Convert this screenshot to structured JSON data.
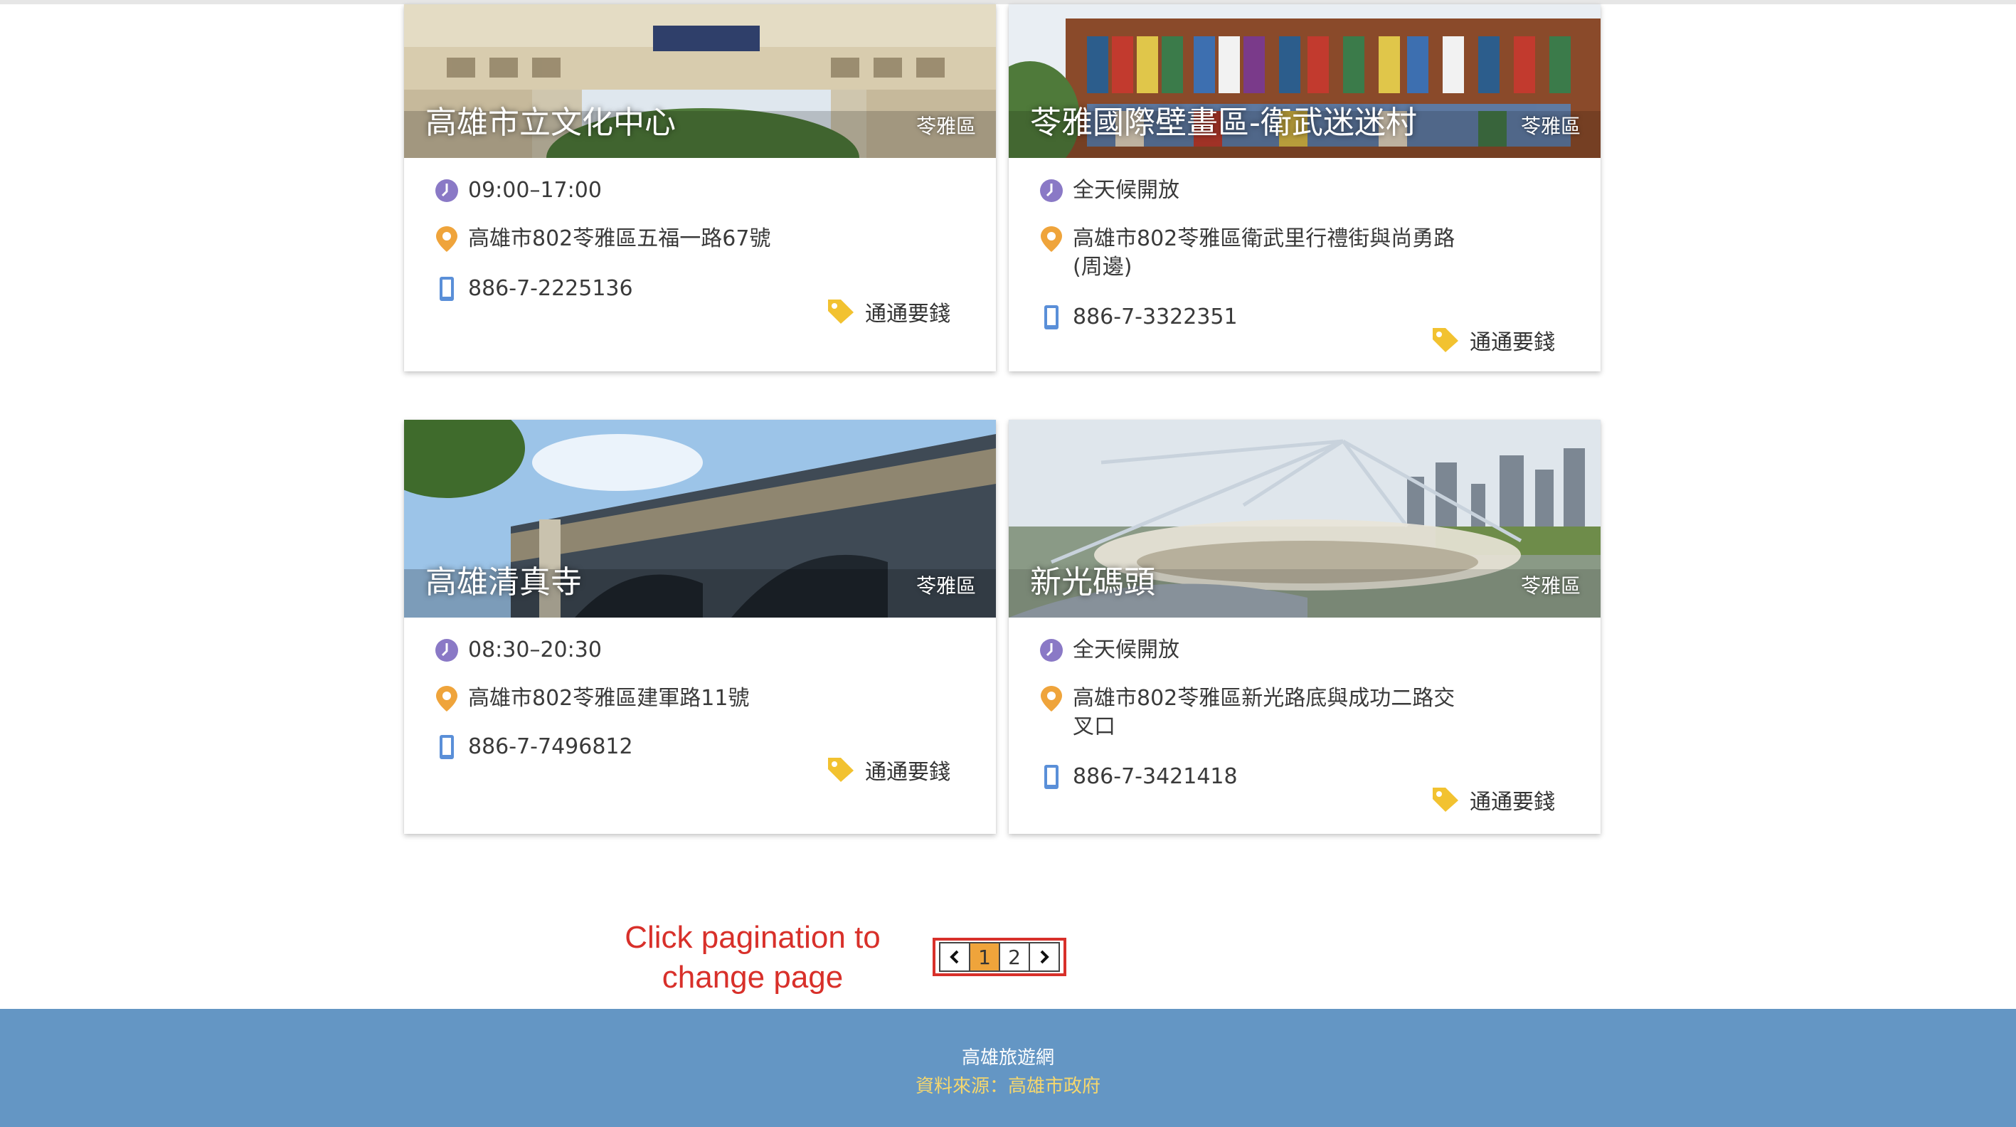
{
  "colors": {
    "footer_bg": "#6496c4",
    "hint_red": "#d8302a",
    "active_page": "#efa43b",
    "clock_icon": "#8a79c6",
    "pin_icon": "#efa43b",
    "phone_icon": "#5a8fd8",
    "tag_icon": "#f2c230"
  },
  "icons": {
    "hours": "clock-icon",
    "address": "map-pin-icon",
    "phone": "mobile-phone-icon",
    "price": "price-tag-icon",
    "prev": "chevron-left-icon",
    "next": "chevron-right-icon"
  },
  "cards": [
    {
      "title": "高雄市立文化中心",
      "district": "苓雅區",
      "hours": "09:00–17:00",
      "address": "高雄市802苓雅區五福一路67號",
      "phone": "886-7-2225136",
      "price": "通通要錢"
    },
    {
      "title": "苓雅國際壁畫區-衛武迷迷村",
      "district": "苓雅區",
      "hours": "全天候開放",
      "address": "高雄市802苓雅區衛武里行禮街與尚勇路(周邊)",
      "phone": "886-7-3322351",
      "price": "通通要錢"
    },
    {
      "title": "高雄清真寺",
      "district": "苓雅區",
      "hours": "08:30–20:30",
      "address": "高雄市802苓雅區建軍路11號",
      "phone": "886-7-7496812",
      "price": "通通要錢"
    },
    {
      "title": "新光碼頭",
      "district": "苓雅區",
      "hours": "全天候開放",
      "address": "高雄市802苓雅區新光路底與成功二路交叉口",
      "phone": "886-7-3421418",
      "price": "通通要錢"
    }
  ],
  "annotation": {
    "line1": "Click pagination to",
    "line2": "change page"
  },
  "pagination": {
    "pages": [
      "1",
      "2"
    ],
    "current": "1"
  },
  "footer": {
    "site_name": "高雄旅遊網",
    "source": "資料來源：高雄市政府"
  }
}
